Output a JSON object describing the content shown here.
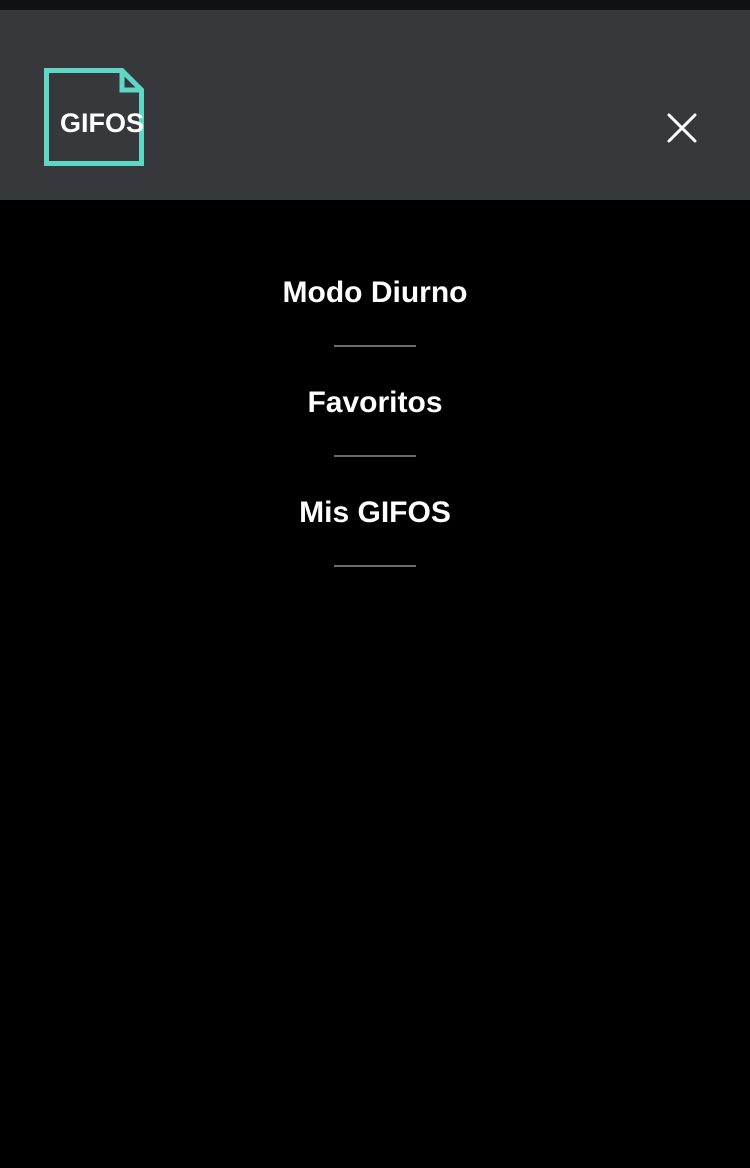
{
  "header": {
    "logo_text": "GIFOS",
    "logo_icon": "document-icon",
    "close_icon": "close-icon"
  },
  "menu": {
    "items": [
      {
        "label": "Modo Diurno"
      },
      {
        "label": "Favoritos"
      },
      {
        "label": "Mis GIFOS"
      }
    ]
  },
  "colors": {
    "background": "#000000",
    "header_background": "#37383c",
    "accent": "#5ed7c6",
    "text": "#ffffff",
    "divider": "#6b6b6b"
  }
}
